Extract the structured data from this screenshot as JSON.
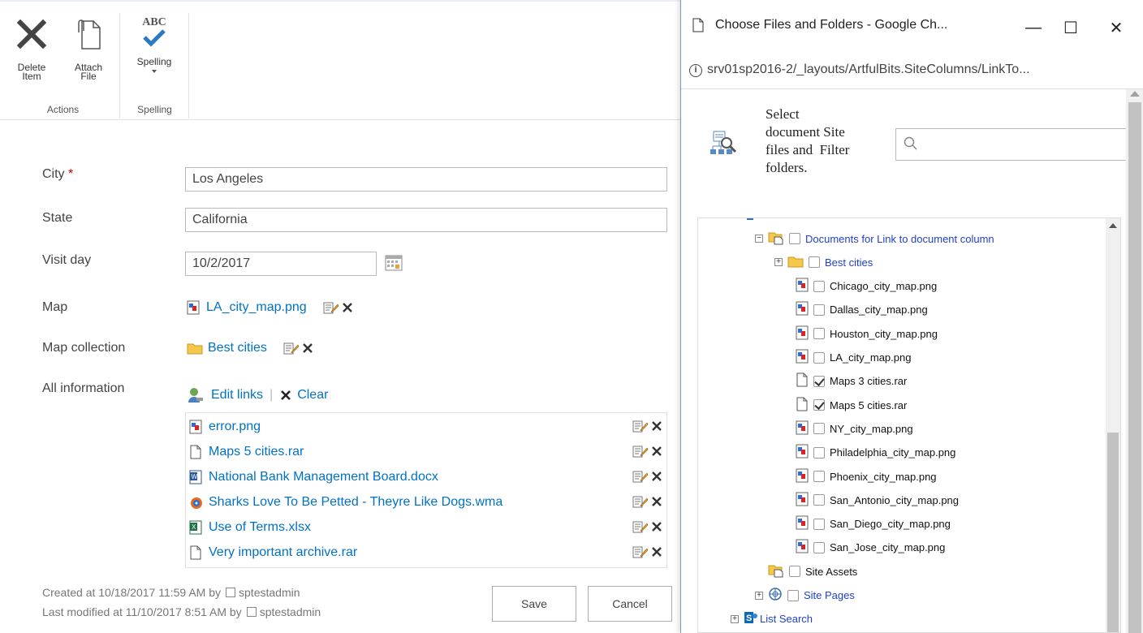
{
  "ribbon": {
    "delete_label": "Delete Item",
    "attach_label": "Attach File",
    "spelling_label": "Spelling",
    "abc": "ABC",
    "actions_group": "Actions",
    "spelling_group": "Spelling"
  },
  "form": {
    "city_label": "City",
    "required_mark": " *",
    "city_value": "Los Angeles",
    "state_label": "State",
    "state_value": "California",
    "visit_label": "Visit day",
    "visit_value": "10/2/2017",
    "map_label": "Map",
    "map_file": "LA_city_map.png",
    "collection_label": "Map collection",
    "collection_value": "Best cities",
    "all_label": "All information",
    "edit_links": "Edit links",
    "separator": "|",
    "clear": "Clear",
    "links": [
      {
        "name": "error.png",
        "icon": "png-file-icon"
      },
      {
        "name": "Maps 5 cities.rar",
        "icon": "generic-file-icon"
      },
      {
        "name": "National Bank Management Board.docx",
        "icon": "word-file-icon"
      },
      {
        "name": "Sharks Love To Be Petted - Theyre Like Dogs.wma",
        "icon": "media-file-icon"
      },
      {
        "name": "Use of Terms.xlsx",
        "icon": "excel-file-icon"
      },
      {
        "name": "Very important archive.rar",
        "icon": "generic-file-icon"
      }
    ],
    "created_prefix": "Created at 10/18/2017 11:59 AM  by",
    "created_user": "sptestadmin",
    "modified_prefix": "Last modified at 11/10/2017 8:51 AM  by",
    "modified_user": "sptestadmin",
    "save": "Save",
    "cancel": "Cancel"
  },
  "dialog": {
    "title": "Choose Files and Folders - Google Ch...",
    "url": "srv01sp2016-2/_layouts/ArtfulBits.SiteColumns/LinkTo...",
    "minimize": "—",
    "maximize": "☐",
    "close": "✕",
    "header_col1": [
      "Select",
      "document",
      "files and",
      "folders."
    ],
    "header_site": "Site",
    "header_filter": "Filter",
    "tree": [
      {
        "label": "Documents for Link to document column",
        "expander": "⊟",
        "icon": "library-icon",
        "checked": false,
        "blue": true
      },
      {
        "label": "Best cities",
        "expander": "⊞",
        "icon": "folder-icon",
        "checked": false,
        "blue": true
      },
      {
        "label": "Chicago_city_map.png",
        "icon": "png-file-icon",
        "checked": false
      },
      {
        "label": "Dallas_city_map.png",
        "icon": "png-file-icon",
        "checked": false
      },
      {
        "label": "Houston_city_map.png",
        "icon": "png-file-icon",
        "checked": false
      },
      {
        "label": "LA_city_map.png",
        "icon": "png-file-icon",
        "checked": false
      },
      {
        "label": "Maps 3 cities.rar",
        "icon": "generic-file-icon",
        "checked": true
      },
      {
        "label": "Maps 5 cities.rar",
        "icon": "generic-file-icon",
        "checked": true
      },
      {
        "label": "NY_city_map.png",
        "icon": "png-file-icon",
        "checked": false
      },
      {
        "label": "Philadelphia_city_map.png",
        "icon": "png-file-icon",
        "checked": false
      },
      {
        "label": "Phoenix_city_map.png",
        "icon": "png-file-icon",
        "checked": false
      },
      {
        "label": "San_Antonio_city_map.png",
        "icon": "png-file-icon",
        "checked": false
      },
      {
        "label": "San_Diego_city_map.png",
        "icon": "png-file-icon",
        "checked": false
      },
      {
        "label": "San_Jose_city_map.png",
        "icon": "png-file-icon",
        "checked": false
      },
      {
        "label": "Site Assets",
        "icon": "library-icon",
        "checked": false
      },
      {
        "label": "Site Pages",
        "expander": "⊞",
        "icon": "pages-icon",
        "checked": false,
        "blue": true
      },
      {
        "label": "List Search",
        "expander": "⊞",
        "icon": "sharepoint-icon",
        "checked": null,
        "blue": true
      }
    ]
  },
  "colors": {
    "accent": "#0072c6",
    "tree_link": "#1f3fcc",
    "required": "#bf0000"
  }
}
